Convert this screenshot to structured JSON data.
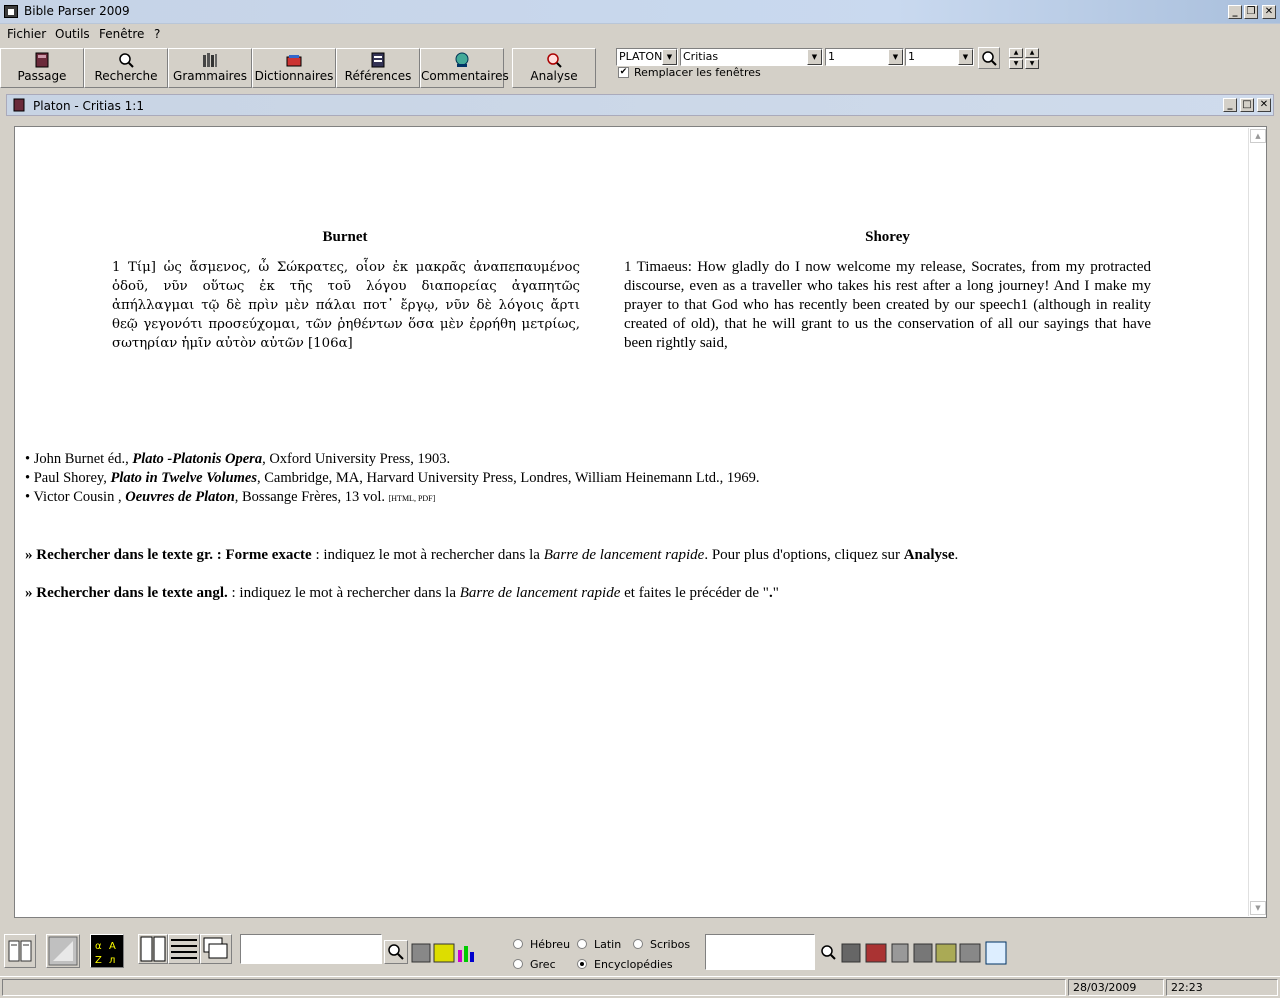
{
  "app": {
    "title": "Bible Parser 2009"
  },
  "menu": {
    "items": [
      "Fichier",
      "Outils",
      "Fenêtre",
      "?"
    ]
  },
  "toolbar": {
    "buttons": [
      "Passage",
      "Recherche",
      "Grammaires",
      "Dictionnaires",
      "Références",
      "Commentaires",
      "Analyse"
    ],
    "author_select": "PLATON",
    "work_select": "Critias",
    "chapter_select": "1",
    "verse_select": "1",
    "replace_windows_label": "Remplacer les fenêtres",
    "replace_windows_checked": true
  },
  "child_window": {
    "title": "Platon - Critias 1:1"
  },
  "document": {
    "left_heading": "Burnet",
    "right_heading": "Shorey",
    "greek_text": "1 Τίμ] ὡς ἄσμενος, ὦ Σώκρατες, οἷον ἐκ μακρᾶς ἀναπεπαυμένος ὁδοῦ, νῦν οὕτως ἐκ τῆς τοῦ λόγου διαπορείας ἀγαπητῶς ἀπήλλαγμαι τῷ δὲ πρὶν μὲν πάλαι ποτ᾽ ἔργῳ, νῦν δὲ λόγοις ἄρτι θεῷ γεγονότι προσεύχομαι, τῶν ῥηθέντων ὅσα μὲν ἐρρήθη μετρίως, σωτηρίαν ἡμῖν αὐτὸν αὐτῶν [106α]",
    "english_text": "1 Timaeus: How gladly do I now welcome my release, Socrates, from my protracted discourse, even as a traveller who takes his rest after a long journey! And I make my prayer to that God who has recently been created by our speech1 (although in reality created of old), that he will grant to us the conservation of all our sayings that have been rightly said,",
    "references": [
      {
        "pre": "• John Burnet éd., ",
        "title": "Plato -Platonis Opera",
        "post": ", Oxford University Press, 1903.",
        "tag": ""
      },
      {
        "pre": "• Paul Shorey, ",
        "title": "Plato in Twelve Volumes",
        "post": ", Cambridge, MA, Harvard University Press, Londres, William Heinemann Ltd., 1969.",
        "tag": ""
      },
      {
        "pre": "• Victor Cousin , ",
        "title": "Oeuvres de Platon",
        "post": ", Bossange Frères, 13 vol. ",
        "tag": "[HTML, PDF]"
      }
    ],
    "search_gr": {
      "label": "» Rechercher dans le texte gr. : Forme exacte",
      "t1": " : indiquez le mot à rechercher dans la ",
      "em": "Barre de lancement rapide",
      "t2": ". Pour plus d'options, cliquez sur ",
      "strong": "Analyse",
      "t3": "."
    },
    "search_en": {
      "label": "» Rechercher dans le texte angl.",
      "t1": " : indiquez le mot à rechercher dans la ",
      "em": "Barre de lancement rapide",
      "t2": " et faites le précéder de \"",
      "strong": ".",
      "t3": "\""
    }
  },
  "bottom": {
    "radios": [
      {
        "label": "Hébreu",
        "checked": false
      },
      {
        "label": "Latin",
        "checked": false
      },
      {
        "label": "Scribos",
        "checked": false
      },
      {
        "label": "Grec",
        "checked": false
      },
      {
        "label": "Encyclopédies",
        "checked": true
      }
    ]
  },
  "status": {
    "date": "28/03/2009",
    "time": "22:23"
  }
}
